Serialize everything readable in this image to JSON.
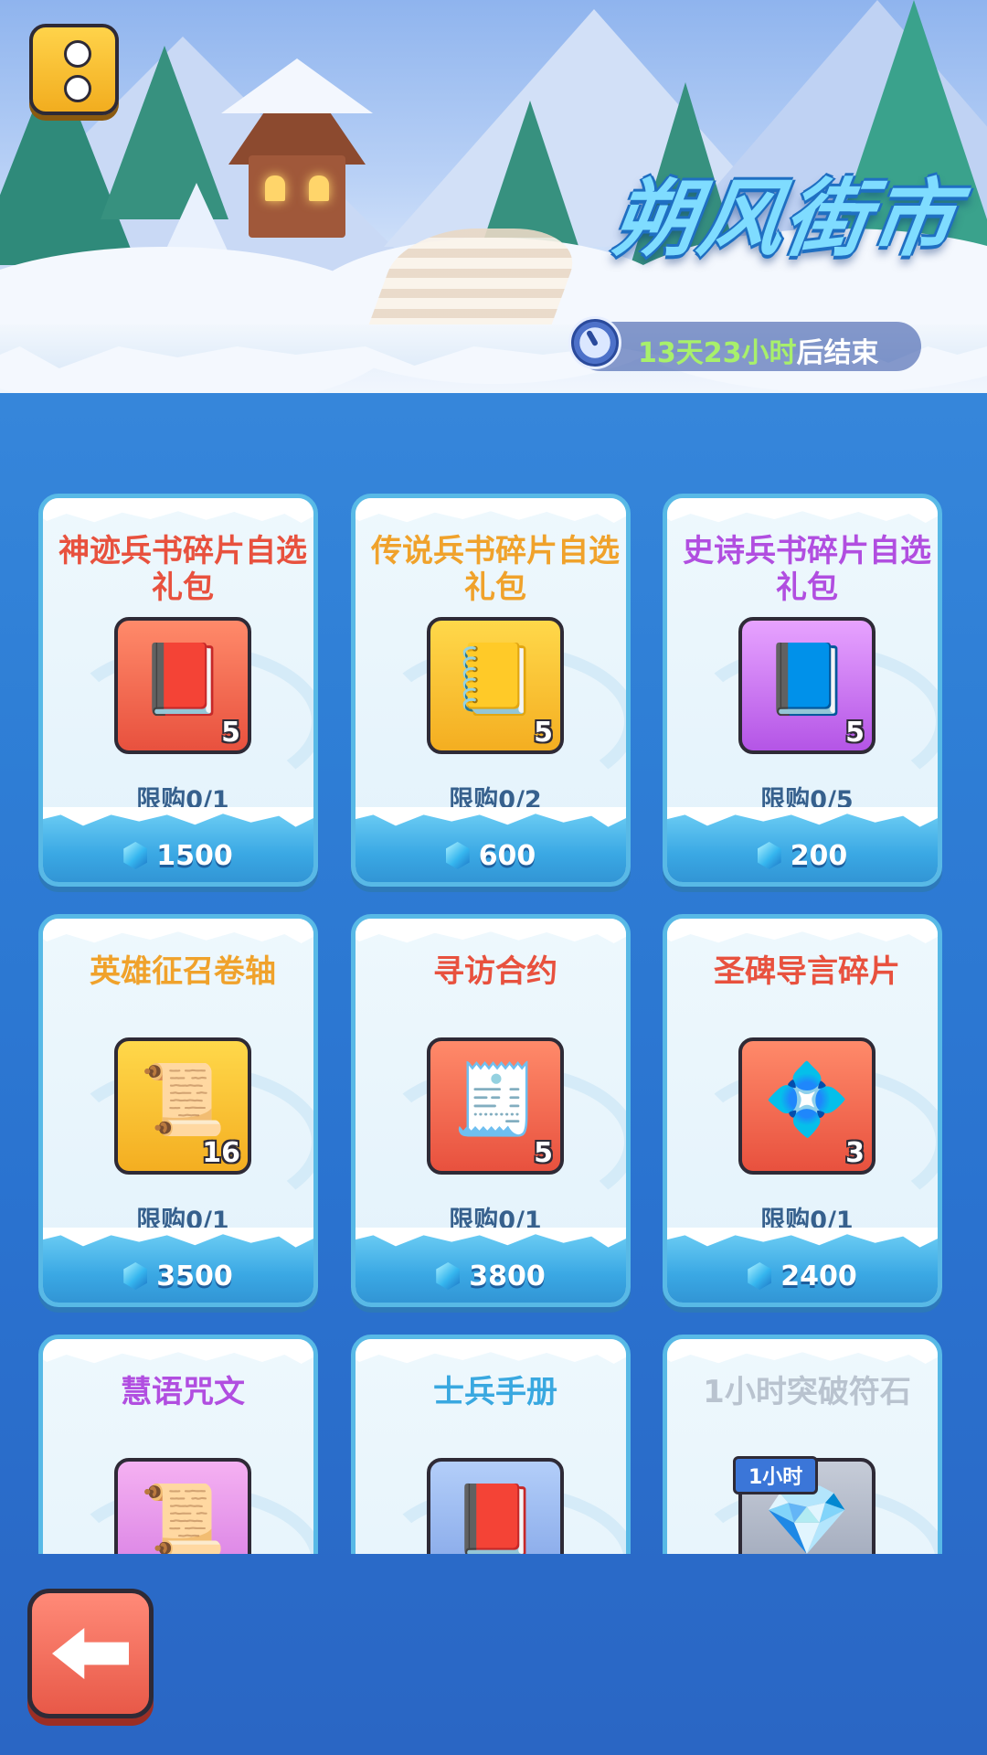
{
  "event": {
    "title": "朔风街市",
    "timer_days": "13天23小时",
    "timer_suffix": "后结束"
  },
  "items": [
    {
      "name": "神迹兵书碎片自选礼包",
      "name_color": "#e8513e",
      "icon": "red-book-chest-icon",
      "glyph": "📕",
      "bg": "bg-red",
      "count": "5",
      "limit": "限购0/1",
      "price": "1500"
    },
    {
      "name": "传说兵书碎片自选礼包",
      "name_color": "#f0a22b",
      "icon": "gold-book-chest-icon",
      "glyph": "📒",
      "bg": "bg-gold",
      "count": "5",
      "limit": "限购0/2",
      "price": "600"
    },
    {
      "name": "史诗兵书碎片自选礼包",
      "name_color": "#b14ee0",
      "icon": "purple-book-chest-icon",
      "glyph": "📘",
      "bg": "bg-purple",
      "count": "5",
      "limit": "限购0/5",
      "price": "200"
    },
    {
      "name": "英雄征召卷轴",
      "name_color": "#f0a22b",
      "icon": "scroll-icon",
      "glyph": "📜",
      "bg": "bg-gold",
      "count": "16",
      "limit": "限购0/1",
      "price": "3500"
    },
    {
      "name": "寻访合约",
      "name_color": "#e8513e",
      "icon": "contract-scroll-icon",
      "glyph": "🧾",
      "bg": "bg-red",
      "count": "5",
      "limit": "限购0/1",
      "price": "3800"
    },
    {
      "name": "圣碑导言碎片",
      "name_color": "#e8513e",
      "icon": "rune-fragment-icon",
      "glyph": "💠",
      "bg": "bg-red",
      "count": "3",
      "limit": "限购0/1",
      "price": "2400"
    },
    {
      "name": "慧语咒文",
      "name_color": "#b14ee0",
      "icon": "spell-scroll-icon",
      "glyph": "📜",
      "bg": "bg-pink",
      "count": "",
      "limit": "",
      "price": ""
    },
    {
      "name": "士兵手册",
      "name_color": "#39a8e0",
      "icon": "manual-book-icon",
      "glyph": "📕",
      "bg": "bg-blue",
      "count": "",
      "limit": "",
      "price": ""
    },
    {
      "name": "1小时突破符石",
      "name_color": "#b9c3cf",
      "icon": "crystal-icon",
      "glyph": "💎",
      "bg": "bg-grey",
      "count": "",
      "limit": "",
      "price": "",
      "tag": "1小时"
    }
  ],
  "colors": {
    "accent_gold": "#f2ad1f",
    "back_red": "#e85948",
    "ice_blue": "#3aa8e4"
  }
}
